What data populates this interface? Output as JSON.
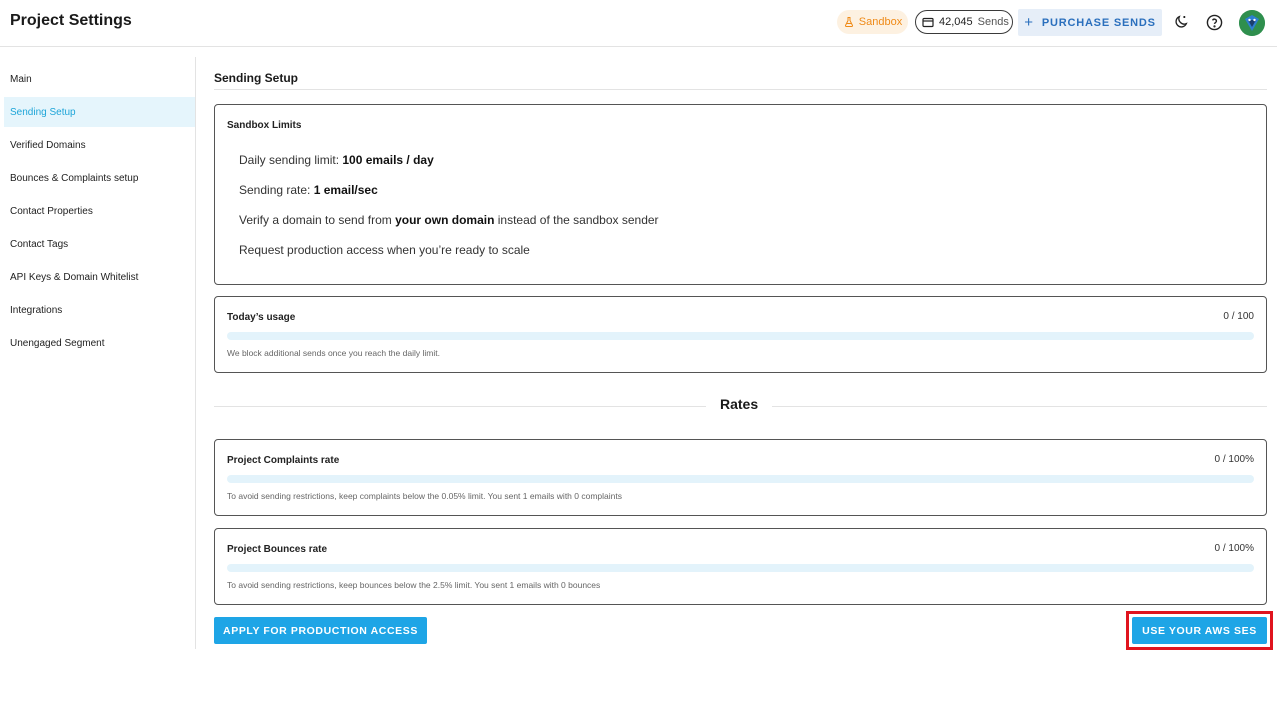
{
  "header": {
    "title": "Project Settings",
    "sandbox_label": "Sandbox",
    "sends_count": "42,045",
    "sends_unit": "Sends",
    "purchase_label": "PURCHASE SENDS",
    "icons": [
      "flask-icon",
      "credit-card-icon",
      "plus-icon",
      "dark-mode-icon",
      "help-icon",
      "avatar"
    ],
    "colors": {
      "sandbox_text": "#ef8a17",
      "purchase_text": "#2a6fbd"
    }
  },
  "sidebar": {
    "items": [
      {
        "label": "Main",
        "active": false
      },
      {
        "label": "Sending Setup",
        "active": true
      },
      {
        "label": "Verified Domains",
        "active": false
      },
      {
        "label": "Bounces & Complaints setup",
        "active": false
      },
      {
        "label": "Contact Properties",
        "active": false
      },
      {
        "label": "Contact Tags",
        "active": false
      },
      {
        "label": "API Keys & Domain Whitelist",
        "active": false
      },
      {
        "label": "Integrations",
        "active": false
      },
      {
        "label": "Unengaged Segment",
        "active": false
      }
    ],
    "active_color": "#1ea5d8"
  },
  "main": {
    "section_title": "Sending Setup",
    "sandbox_limits": {
      "title": "Sandbox Limits",
      "daily_prefix": "Daily sending limit: ",
      "daily_value": "100 emails / day",
      "rate_prefix": "Sending rate: ",
      "rate_value": "1 email/sec",
      "verify_prefix": "Verify a domain to send from ",
      "verify_bold": "your own domain",
      "verify_suffix": " instead of the sandbox sender",
      "production_line": "Request production access when you’re ready to scale"
    },
    "usage": {
      "title": "Today’s usage",
      "value": "0 / 100",
      "fill": 0,
      "note": "We block additional sends once you reach the daily limit."
    },
    "rates_title": "Rates",
    "complaints": {
      "title": "Project Complaints rate",
      "value": "0 / 100%",
      "fill": 0,
      "note": "To avoid sending restrictions, keep complaints below the 0.05% limit. You sent 1 emails with 0 complaints"
    },
    "bounces": {
      "title": "Project Bounces rate",
      "value": "0 / 100%",
      "fill": 0,
      "note": "To avoid sending restrictions, keep bounces below the 2.5% limit. You sent 1 emails with 0 bounces"
    },
    "apply_button": "APPLY FOR PRODUCTION ACCESS",
    "aws_button": "USE YOUR AWS SES",
    "button_color": "#1ea5e6",
    "highlight_color": "#e0141e"
  }
}
